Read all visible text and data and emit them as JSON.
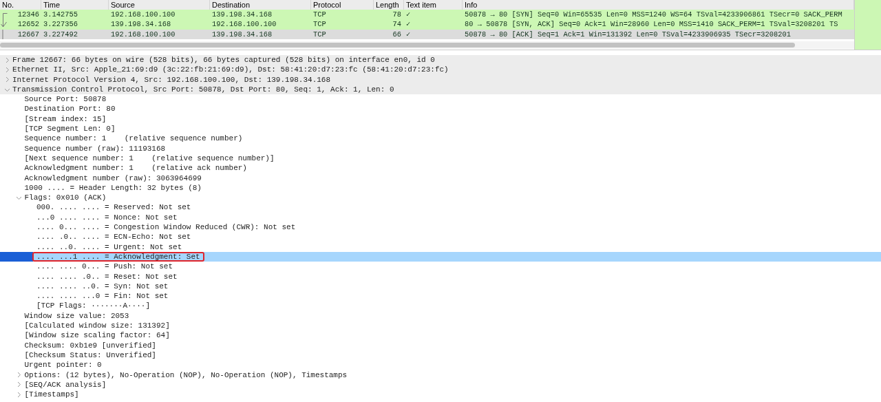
{
  "packet_list": {
    "columns": [
      "No.",
      "Time",
      "Source",
      "Destination",
      "Protocol",
      "Length",
      "Text item",
      "Info"
    ],
    "rows": [
      {
        "no": "12346",
        "time": "3.142755",
        "source": "192.168.100.100",
        "destination": "139.198.34.168",
        "protocol": "TCP",
        "length": "78",
        "text_item": "✓",
        "info": "50878 → 80 [SYN] Seq=0 Win=65535 Len=0 MSS=1240 WS=64 TSval=4233906861 TSecr=0 SACK_PERM",
        "color": "#ccf7b4",
        "kind": "start"
      },
      {
        "no": "12652",
        "time": "3.227356",
        "source": "139.198.34.168",
        "destination": "192.168.100.100",
        "protocol": "TCP",
        "length": "74",
        "text_item": "✓",
        "info": "80 → 50878 [SYN, ACK] Seq=0 Ack=1 Win=28960 Len=0 MSS=1410 SACK_PERM=1 TSval=3208201 TS",
        "color": "#ccf7b4",
        "kind": "response"
      },
      {
        "no": "12667",
        "time": "3.227492",
        "source": "192.168.100.100",
        "destination": "139.198.34.168",
        "protocol": "TCP",
        "length": "66",
        "text_item": "✓",
        "info": "50878 → 80 [ACK] Seq=1 Ack=1 Win=131392 Len=0 TSval=4233906935 TSecr=3208201",
        "color": "#dcdcdc",
        "kind": "end"
      }
    ]
  },
  "detail_tree": [
    {
      "text": "Frame 12667: 66 bytes on wire (528 bits), 66 bytes captured (528 bits) on interface en0, id 0",
      "expanded": false,
      "selected": false
    },
    {
      "text": "Ethernet II, Src: Apple_21:69:d9 (3c:22:fb:21:69:d9), Dst: 58:41:20:d7:23:fc (58:41:20:d7:23:fc)",
      "expanded": false,
      "selected": false
    },
    {
      "text": "Internet Protocol Version 4, Src: 192.168.100.100, Dst: 139.198.34.168",
      "expanded": false,
      "selected": false
    },
    {
      "text": "Transmission Control Protocol, Src Port: 50878, Dst Port: 80, Seq: 1, Ack: 1, Len: 0",
      "expanded": true,
      "selected": false,
      "children": [
        {
          "text": "Source Port: 50878",
          "selected": false
        },
        {
          "text": "Destination Port: 80",
          "selected": false
        },
        {
          "text": "[Stream index: 15]",
          "selected": false
        },
        {
          "text": "[TCP Segment Len: 0]",
          "selected": false
        },
        {
          "text": "Sequence number: 1    (relative sequence number)",
          "selected": false
        },
        {
          "text": "Sequence number (raw): 11193168",
          "selected": false
        },
        {
          "text": "[Next sequence number: 1    (relative sequence number)]",
          "selected": false
        },
        {
          "text": "Acknowledgment number: 1    (relative ack number)",
          "selected": false
        },
        {
          "text": "Acknowledgment number (raw): 3063964699",
          "selected": false
        },
        {
          "text": "1000 .... = Header Length: 32 bytes (8)",
          "selected": false
        },
        {
          "text": "Flags: 0x010 (ACK)",
          "expanded": true,
          "selected": false,
          "children": [
            {
              "text": "000. .... .... = Reserved: Not set",
              "selected": false,
              "boxed": false
            },
            {
              "text": "...0 .... .... = Nonce: Not set",
              "selected": false,
              "boxed": false
            },
            {
              "text": ".... 0... .... = Congestion Window Reduced (CWR): Not set",
              "selected": false,
              "boxed": false
            },
            {
              "text": ".... .0.. .... = ECN-Echo: Not set",
              "selected": false,
              "boxed": false
            },
            {
              "text": ".... ..0. .... = Urgent: Not set",
              "selected": false,
              "boxed": false
            },
            {
              "text": ".... ...1 .... = Acknowledgment: Set",
              "selected": true,
              "boxed": true
            },
            {
              "text": ".... .... 0... = Push: Not set",
              "selected": false,
              "boxed": false
            },
            {
              "text": ".... .... .0.. = Reset: Not set",
              "selected": false,
              "boxed": false
            },
            {
              "text": ".... .... ..0. = Syn: Not set",
              "selected": false,
              "boxed": false
            },
            {
              "text": ".... .... ...0 = Fin: Not set",
              "selected": false,
              "boxed": false
            },
            {
              "text": "[TCP Flags: ·······A····]",
              "selected": false,
              "boxed": false
            }
          ]
        },
        {
          "text": "Window size value: 2053",
          "selected": false
        },
        {
          "text": "[Calculated window size: 131392]",
          "selected": false
        },
        {
          "text": "[Window size scaling factor: 64]",
          "selected": false
        },
        {
          "text": "Checksum: 0xb1e9 [unverified]",
          "selected": false
        },
        {
          "text": "[Checksum Status: Unverified]",
          "selected": false
        },
        {
          "text": "Urgent pointer: 0",
          "selected": false
        },
        {
          "text": "Options: (12 bytes), No-Operation (NOP), No-Operation (NOP), Timestamps",
          "expanded": false,
          "selected": false
        },
        {
          "text": "[SEQ/ACK analysis]",
          "expanded": false,
          "selected": false
        },
        {
          "text": "[Timestamps]",
          "expanded": false,
          "selected": false
        }
      ]
    }
  ]
}
